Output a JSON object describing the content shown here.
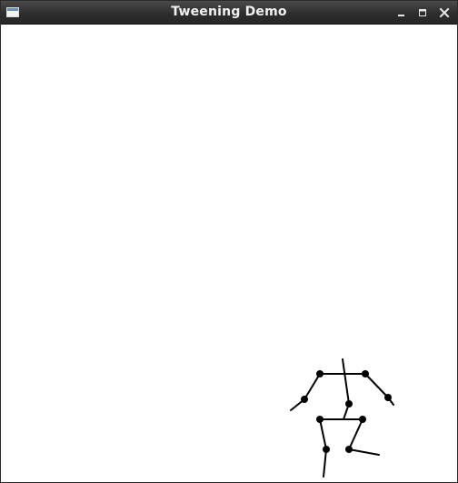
{
  "window": {
    "title": "Tweening Demo",
    "controls": {
      "minimize_icon": "minimize-icon",
      "maximize_icon": "maximize-icon",
      "close_icon": "close-icon"
    },
    "app_icon": "window-icon"
  },
  "canvas": {
    "background": "#ffffff",
    "figure_color": "#000000"
  }
}
